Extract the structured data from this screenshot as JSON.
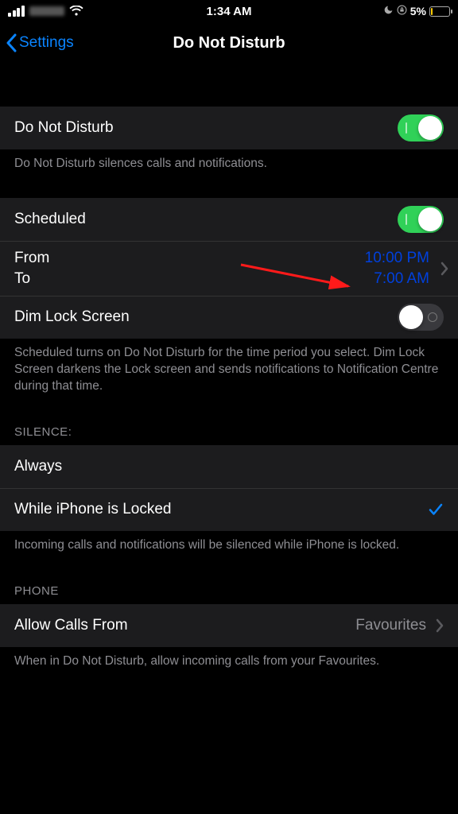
{
  "status": {
    "time": "1:34 AM",
    "battery_pct": "5%"
  },
  "nav": {
    "back_label": "Settings",
    "title": "Do Not Disturb"
  },
  "dnd": {
    "label": "Do Not Disturb",
    "on": true,
    "footer": "Do Not Disturb silences calls and notifications."
  },
  "scheduled": {
    "label": "Scheduled",
    "on": true,
    "from_label": "From",
    "to_label": "To",
    "from_time": "10:00 PM",
    "to_time": "7:00 AM",
    "dim_label": "Dim Lock Screen",
    "dim_on": false,
    "footer": "Scheduled turns on Do Not Disturb for the time period you select. Dim Lock Screen darkens the Lock screen and sends notifications to Notification Centre during that time."
  },
  "silence": {
    "header": "SILENCE:",
    "always": "Always",
    "locked": "While iPhone is Locked",
    "selected": "locked",
    "footer": "Incoming calls and notifications will be silenced while iPhone is locked."
  },
  "phone": {
    "header": "PHONE",
    "allow_label": "Allow Calls From",
    "allow_value": "Favourites",
    "footer": "When in Do Not Disturb, allow incoming calls from your Favourites."
  }
}
